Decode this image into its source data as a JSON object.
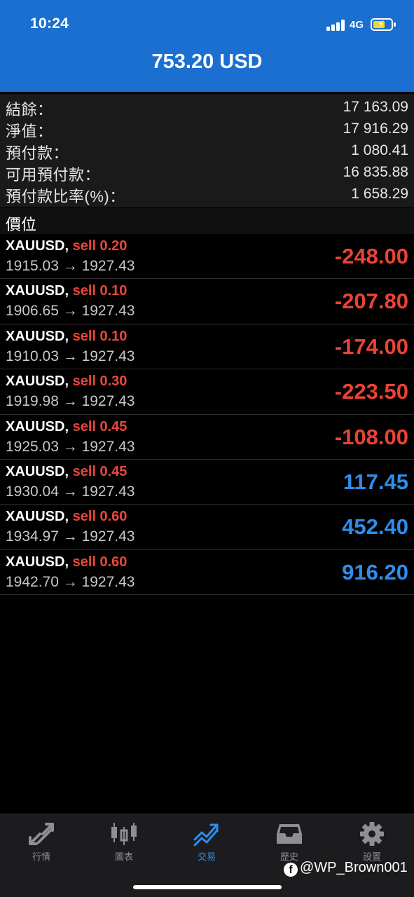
{
  "status": {
    "time": "10:24",
    "network": "4G"
  },
  "header": {
    "title": "753.20 USD"
  },
  "summary": [
    {
      "label": "結餘：",
      "value": "17 163.09"
    },
    {
      "label": "淨值：",
      "value": "17 916.29"
    },
    {
      "label": "預付款：",
      "value": "1 080.41"
    },
    {
      "label": "可用預付款：",
      "value": "16 835.88"
    },
    {
      "label": "預付款比率(%)：",
      "value": "1 658.29"
    }
  ],
  "positions_title": "價位",
  "positions": [
    {
      "symbol": "XAUUSD,",
      "side": "sell 0.20",
      "prices": "1915.03 → 1927.43",
      "profit": "-248.00",
      "sign": "neg"
    },
    {
      "symbol": "XAUUSD,",
      "side": "sell 0.10",
      "prices": "1906.65 → 1927.43",
      "profit": "-207.80",
      "sign": "neg"
    },
    {
      "symbol": "XAUUSD,",
      "side": "sell 0.10",
      "prices": "1910.03 → 1927.43",
      "profit": "-174.00",
      "sign": "neg"
    },
    {
      "symbol": "XAUUSD,",
      "side": "sell 0.30",
      "prices": "1919.98 → 1927.43",
      "profit": "-223.50",
      "sign": "neg"
    },
    {
      "symbol": "XAUUSD,",
      "side": "sell 0.45",
      "prices": "1925.03 → 1927.43",
      "profit": "-108.00",
      "sign": "neg"
    },
    {
      "symbol": "XAUUSD,",
      "side": "sell 0.45",
      "prices": "1930.04 → 1927.43",
      "profit": "117.45",
      "sign": "pos"
    },
    {
      "symbol": "XAUUSD,",
      "side": "sell 0.60",
      "prices": "1934.97 → 1927.43",
      "profit": "452.40",
      "sign": "pos"
    },
    {
      "symbol": "XAUUSD,",
      "side": "sell 0.60",
      "prices": "1942.70 → 1927.43",
      "profit": "916.20",
      "sign": "pos"
    }
  ],
  "tabs": [
    {
      "label": "行情",
      "icon": "quotes-arrows-icon"
    },
    {
      "label": "圖表",
      "icon": "candlestick-chart-icon"
    },
    {
      "label": "交易",
      "icon": "trade-trend-icon",
      "active": true
    },
    {
      "label": "歷史",
      "icon": "history-inbox-icon"
    },
    {
      "label": "設置",
      "icon": "gear-icon"
    }
  ],
  "watermark": "@WP_Brown001",
  "colors": {
    "header": "#1b6fd0",
    "loss": "#ea4335",
    "gain": "#2e8eea",
    "sell": "#e8473b"
  }
}
